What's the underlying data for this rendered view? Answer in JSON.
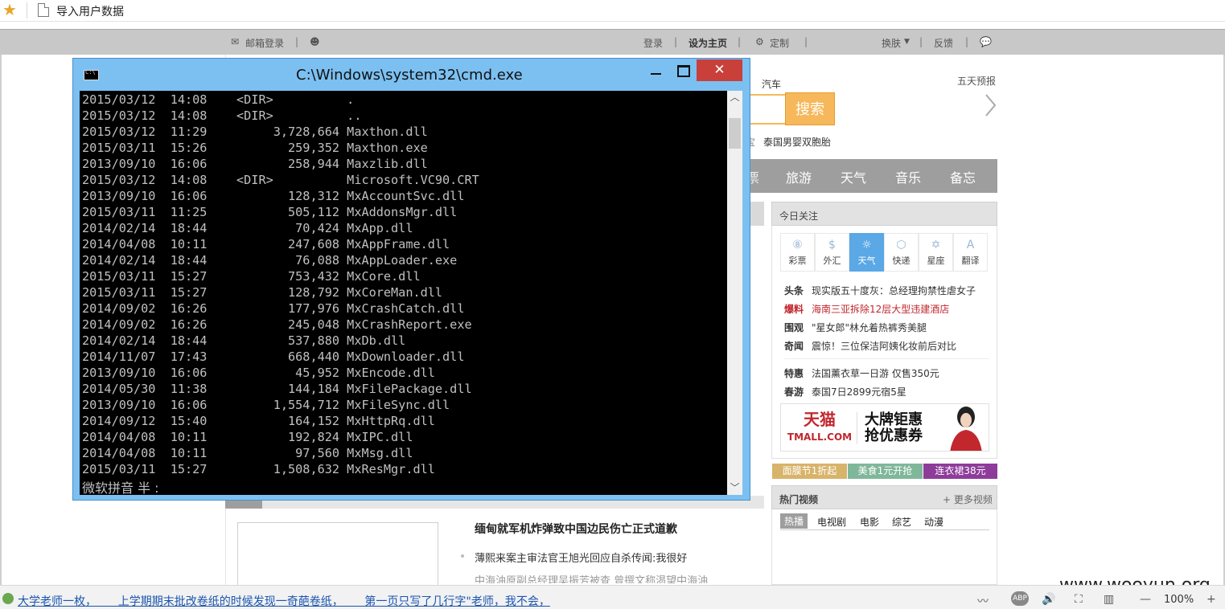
{
  "browser": {
    "tab_title": "导入用户数据",
    "zoom": "100%"
  },
  "sitebar": {
    "mail_login": "邮箱登录",
    "login": "登录",
    "set_home": "设为主页",
    "customize": "定制",
    "skin": "换肤",
    "feedback": "反馈"
  },
  "right": {
    "car_link": "汽车",
    "forecast": "五天预报",
    "search_btn": "搜索",
    "hot_query_1": "泰国男婴双胞胎",
    "nav": [
      "旅游",
      "天气",
      "音乐",
      "备忘"
    ],
    "today_title": "今日关注",
    "tools": [
      "彩票",
      "外汇",
      "天气",
      "快递",
      "星座",
      "翻译"
    ],
    "news": [
      {
        "k": "头条",
        "v": "现实版五十度灰：总经理拘禁性虐女子"
      },
      {
        "k": "爆料",
        "v": "海南三亚拆除12层大型违建酒店"
      },
      {
        "k": "围观",
        "v": "\"星女郎\"林允着热裤秀美腿"
      },
      {
        "k": "奇闻",
        "v": "震惊！三位保洁阿姨化妆前后对比"
      },
      {
        "k": "特惠",
        "v": "法国薰衣草一日游 仅售350元"
      },
      {
        "k": "春游",
        "v": "泰国7日2899元宿5星"
      }
    ],
    "ad": {
      "brand": "天猫",
      "brand_en": "TMALL.COM",
      "slogan": "大牌钜惠 抢优惠券"
    },
    "tags": [
      "面膜节1折起",
      "美食1元开抢",
      "连衣裙38元"
    ],
    "tag_colors": [
      "#d8b36a",
      "#7fb79a",
      "#8e3c9a"
    ],
    "video_title": "热门视频",
    "video_more": "+ 更多视频",
    "video_tabs": [
      "热播",
      "电视剧",
      "电影",
      "综艺",
      "动漫"
    ]
  },
  "main": {
    "headline": "缅甸就军机炸弹致中国边民伤亡正式道歉",
    "sub1": "薄熙来案主审法官王旭光回应自杀传闻:我很好",
    "sub2": "中海油原副总经理吴振芳被查 曾撰文称渴望中海油"
  },
  "cmd": {
    "title": "C:\\Windows\\system32\\cmd.exe",
    "close": "✕",
    "listing": [
      [
        "2015/03/12",
        "14:08",
        "<DIR>",
        "",
        "."
      ],
      [
        "2015/03/12",
        "14:08",
        "<DIR>",
        "",
        ".."
      ],
      [
        "2015/03/12",
        "11:29",
        "",
        "3,728,664",
        "Maxthon.dll"
      ],
      [
        "2015/03/11",
        "15:26",
        "",
        "259,352",
        "Maxthon.exe"
      ],
      [
        "2013/09/10",
        "16:06",
        "",
        "258,944",
        "Maxzlib.dll"
      ],
      [
        "2015/03/12",
        "14:08",
        "<DIR>",
        "",
        "Microsoft.VC90.CRT"
      ],
      [
        "2013/09/10",
        "16:06",
        "",
        "128,312",
        "MxAccountSvc.dll"
      ],
      [
        "2015/03/11",
        "11:25",
        "",
        "505,112",
        "MxAddonsMgr.dll"
      ],
      [
        "2014/02/14",
        "18:44",
        "",
        "70,424",
        "MxApp.dll"
      ],
      [
        "2014/04/08",
        "10:11",
        "",
        "247,608",
        "MxAppFrame.dll"
      ],
      [
        "2014/02/14",
        "18:44",
        "",
        "76,088",
        "MxAppLoader.exe"
      ],
      [
        "2015/03/11",
        "15:27",
        "",
        "753,432",
        "MxCore.dll"
      ],
      [
        "2015/03/11",
        "15:27",
        "",
        "128,792",
        "MxCoreMan.dll"
      ],
      [
        "2014/09/02",
        "16:26",
        "",
        "177,976",
        "MxCrashCatch.dll"
      ],
      [
        "2014/09/02",
        "16:26",
        "",
        "245,048",
        "MxCrashReport.exe"
      ],
      [
        "2014/02/14",
        "18:44",
        "",
        "537,880",
        "MxDb.dll"
      ],
      [
        "2014/11/07",
        "17:43",
        "",
        "668,440",
        "MxDownloader.dll"
      ],
      [
        "2013/09/10",
        "16:06",
        "",
        "45,952",
        "MxEncode.dll"
      ],
      [
        "2014/05/30",
        "11:38",
        "",
        "144,184",
        "MxFilePackage.dll"
      ],
      [
        "2013/09/10",
        "16:06",
        "",
        "1,554,712",
        "MxFileSync.dll"
      ],
      [
        "2014/09/12",
        "15:40",
        "",
        "164,152",
        "MxHttpRq.dll"
      ],
      [
        "2014/04/08",
        "10:11",
        "",
        "192,824",
        "MxIPC.dll"
      ],
      [
        "2014/04/08",
        "10:11",
        "",
        "97,560",
        "MxMsg.dll"
      ],
      [
        "2015/03/11",
        "15:27",
        "",
        "1,508,632",
        "MxResMgr.dll"
      ]
    ],
    "ime_status": "微软拼音 半 :"
  },
  "status": {
    "ticker": "大学老师一枚，      上学期期末批改卷纸的时候发现一奇葩卷纸，      第一页只写了几行字\"老师，我不会，",
    "watermark": "www.wooyun.org"
  }
}
